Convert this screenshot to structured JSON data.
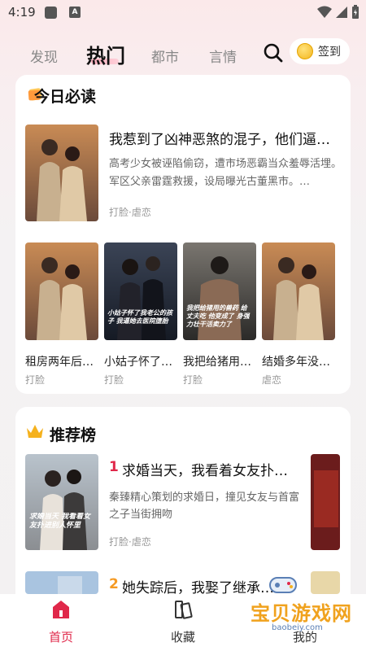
{
  "status": {
    "time": "4:19",
    "a_glyph": "A"
  },
  "tabs": [
    {
      "label": "发现"
    },
    {
      "label": "热门"
    },
    {
      "label": "都市"
    },
    {
      "label": "言情"
    }
  ],
  "signin": {
    "label": "签到"
  },
  "today": {
    "title": "今日必读",
    "featured": {
      "title": "我惹到了凶神恶煞的混子，他们逼…",
      "desc": "高考少女被诬陷偷窃，遭市场恶霸当众羞辱活埋。军区父亲雷霆救援，设局曝光古董黑市。…",
      "tags": "打脸·虐恋"
    },
    "grid": [
      {
        "title": "租房两年后…",
        "tag": "打脸"
      },
      {
        "title": "小姑子怀了…",
        "tag": "打脸",
        "cover_text": "小姑子怀了我老公的孩子 我逼她去医院堕胎"
      },
      {
        "title": "我把给猪用…",
        "tag": "打脸",
        "cover_text": "我把给猪用的兽药 给丈夫吃 他变成了 身强力壮干活卖力了"
      },
      {
        "title": "结婚多年没…",
        "tag": "虐恋"
      }
    ]
  },
  "ranking": {
    "title": "推荐榜",
    "items": [
      {
        "num": "1",
        "title": "求婚当天，我看着女友扑…",
        "desc": "秦臻精心策划的求婚日，撞见女友与首富之子当街拥吻",
        "tags": "打脸·虐恋",
        "cover_text": "求婚当天 我看着女友扑进别人怀里"
      },
      {
        "num": "2",
        "title": "她失踪后，我娶了继承…"
      }
    ]
  },
  "bottom_nav": [
    {
      "label": "首页"
    },
    {
      "label": "收藏"
    },
    {
      "label": "我的"
    }
  ],
  "watermark": {
    "text": "宝贝游戏网",
    "url": "baobeiy.com"
  },
  "colors": {
    "accent": "#e0284a",
    "rank1": "#e0284a",
    "rank2": "#f59a23"
  }
}
